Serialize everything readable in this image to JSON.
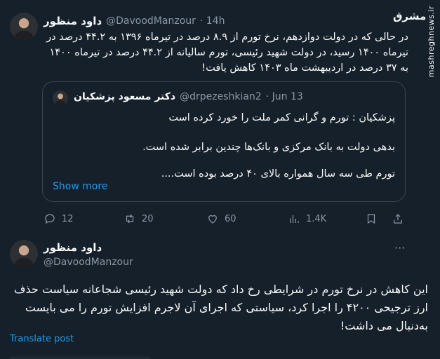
{
  "tweet1": {
    "author_name": "داود منظور",
    "author_handle": "@DavoodManzour",
    "time": "· 14h",
    "text": "در حالی که در دولت دوازدهم، نرخ تورم از ۸.۹ درصد در تیرماه ۱۳۹۶ به ۴۴.۲ درصد در تیرماه ۱۴۰۰ رسید، در دولت شهید رئیسی، تورم سالیانه از ۴۴.۲ درصد در تیرماه ۱۴۰۰ به ۳۷ درصد در اردیبهشت ماه ۱۴۰۳ کاهش یافت!",
    "quote": {
      "author_name": "دکتر مسعود پزشکیان",
      "author_handle": "@drpezeshkian2",
      "time": "· Jun 13",
      "line1": "پزشکیان : تورم و گرانی کمر ملت را خورد کرده است",
      "line2": "بدهی دولت به بانک مرکزی و بانک‌ها چندین برابر شده است.",
      "line3": "تورم طی سه سال همواره بالای ۴۰ درصد بوده است....",
      "show_more": "Show more"
    },
    "actions": {
      "replies": "12",
      "reposts": "20",
      "likes": "60",
      "views": "1.4K"
    }
  },
  "tweet2": {
    "author_name": "داود منظور",
    "author_handle": "@DavoodManzour",
    "more": "···",
    "text": "این کاهش در نرخ تورم در شرایطی رخ داد که دولت شهید رئیسی شجاعانه سیاست حذف ارز ترجیحی ۴۲۰۰ را اجرا کرد، سیاستی که اجرای آن لاجرم افزایش تورم را می بایست به‌دنبال می داشت!",
    "translate": "Translate post"
  },
  "watermark": {
    "logo": "مشرق",
    "site": "mashreghnews.ir"
  },
  "colors": {
    "background": "#15202b",
    "text": "#f7f9f9",
    "muted": "#8b98a5",
    "accent": "#1d9bf0",
    "border": "#38444d"
  }
}
